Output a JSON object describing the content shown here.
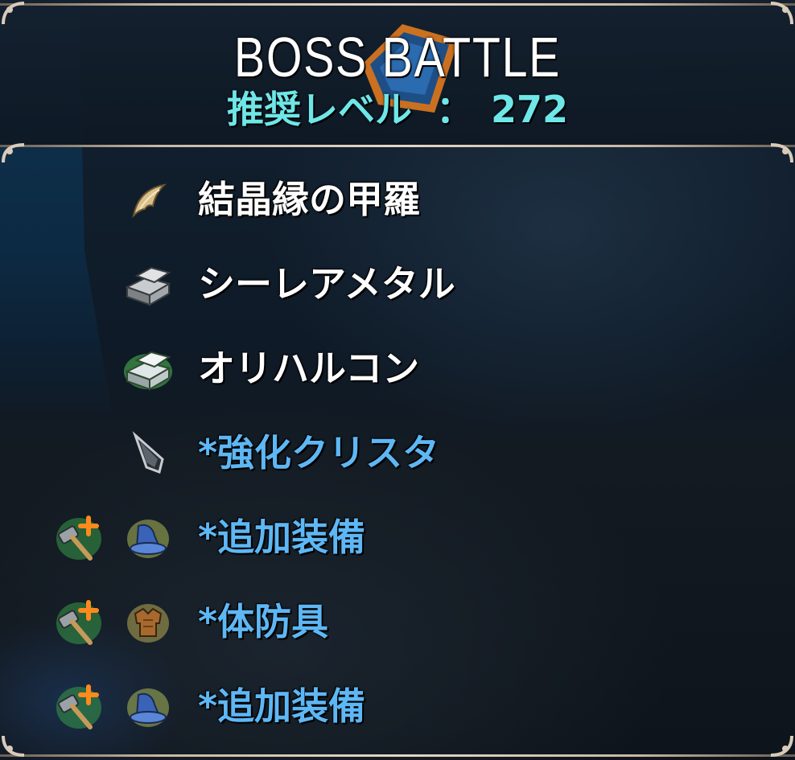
{
  "header": {
    "title": "BOSS BATTLE",
    "recommend_label": "推奨レベル",
    "recommend_sep": "：",
    "recommend_value": "272"
  },
  "drops": [
    {
      "label": "結晶縁の甲羅",
      "color": "#ffffff",
      "icon": "claw-icon",
      "upgrade_icon": null
    },
    {
      "label": "シーレアメタル",
      "color": "#ffffff",
      "icon": "metal-ingot-icon",
      "upgrade_icon": null
    },
    {
      "label": "オリハルコン",
      "color": "#ffffff",
      "icon": "orichalcum-ingot-icon",
      "upgrade_icon": null
    },
    {
      "label": "*強化クリスタ",
      "color": "#5eb7f5",
      "icon": "crystal-shard-icon",
      "upgrade_icon": null
    },
    {
      "label": "*追加装備",
      "color": "#5eb7f5",
      "icon": "wizard-hat-icon",
      "upgrade_icon": "hammer-plus-icon"
    },
    {
      "label": "*体防具",
      "color": "#5eb7f5",
      "icon": "body-armor-icon",
      "upgrade_icon": "hammer-plus-icon"
    },
    {
      "label": "*追加装備",
      "color": "#5eb7f5",
      "icon": "wizard-hat-icon",
      "upgrade_icon": "hammer-plus-icon"
    }
  ],
  "colors": {
    "title": "#ffffff",
    "recommend": "#6fe6e8",
    "material_text": "#ffffff",
    "equipment_text": "#5eb7f5",
    "frame": "#d9cbb9"
  }
}
